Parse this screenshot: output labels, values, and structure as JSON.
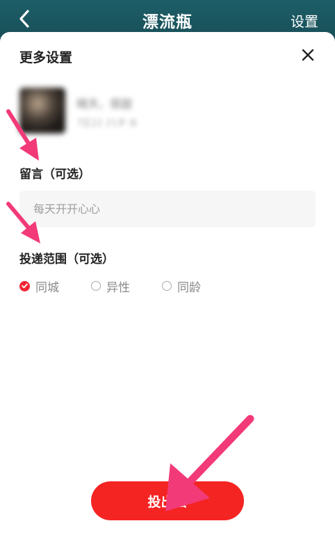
{
  "nav": {
    "title": "漂流瓶",
    "settings_label": "设置"
  },
  "sheet": {
    "title": "更多设置"
  },
  "user": {
    "name": "晴天、很甜",
    "meta": "7区22  21岁·女"
  },
  "message": {
    "label": "留言（可选）",
    "placeholder": "每天开开心心"
  },
  "range": {
    "label": "投递范围（可选）",
    "options": [
      {
        "label": "同城",
        "checked": true
      },
      {
        "label": "异性",
        "checked": false
      },
      {
        "label": "同龄",
        "checked": false
      }
    ]
  },
  "submit_label": "投出去",
  "colors": {
    "accent": "#f42423",
    "header_bg": "#1b5660",
    "annotation_arrow": "#f23a78"
  },
  "icons": {
    "back": "chevron-left-icon",
    "close": "close-icon",
    "radio_checked": "check-icon"
  }
}
